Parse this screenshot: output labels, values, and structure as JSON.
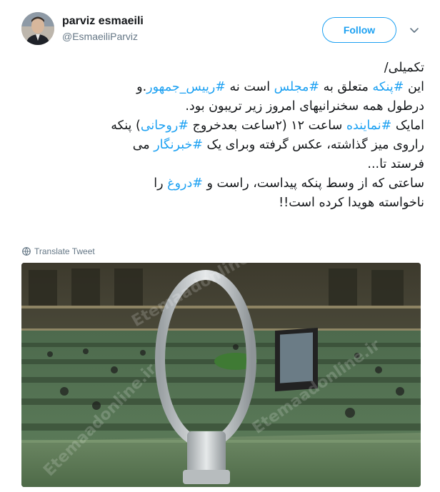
{
  "user": {
    "display_name": "parviz esmaeili",
    "handle": "@EsmaeiliParviz"
  },
  "follow_label": "Follow",
  "tweet": {
    "lines": [
      [
        {
          "t": "تکمیلی/"
        }
      ],
      [
        {
          "t": "این "
        },
        {
          "t": "#پنکه",
          "tag": true
        },
        {
          "t": " متعلق به "
        },
        {
          "t": "#مجلس",
          "tag": true
        },
        {
          "t": " است نه "
        },
        {
          "t": "#رییس_جمهور",
          "tag": true
        },
        {
          "t": ".و"
        }
      ],
      [
        {
          "t": "درطول همه سخنرانیهای امروز زیر تریبون بود."
        }
      ],
      [
        {
          "t": "امایک "
        },
        {
          "t": "#نماینده",
          "tag": true
        },
        {
          "t": " ساعت ۱۲ (۲ساعت بعدخروج "
        },
        {
          "t": "#روحانی",
          "tag": true
        },
        {
          "t": ") پنکه"
        }
      ],
      [
        {
          "t": "راروی میز گذاشته، عکس گرفته وبرای یک "
        },
        {
          "t": "#خبرنگار",
          "tag": true
        },
        {
          "t": " می"
        }
      ],
      [
        {
          "t": "فرستد تا..."
        }
      ],
      [
        {
          "t": "ساعتی که از وسط پنکه پیداست، راست و "
        },
        {
          "t": "#دروغ",
          "tag": true
        },
        {
          "t": " را"
        }
      ],
      [
        {
          "t": "ناخواسته هویدا کرده است!!"
        }
      ]
    ]
  },
  "translate_label": "Translate Tweet",
  "photo": {
    "watermark": "Etemaadonline.ir"
  },
  "icons": {
    "caret": "chevron-down-icon",
    "globe": "globe-icon"
  },
  "colors": {
    "accent": "#1da1f2",
    "text": "#14171a",
    "muted": "#657786"
  }
}
